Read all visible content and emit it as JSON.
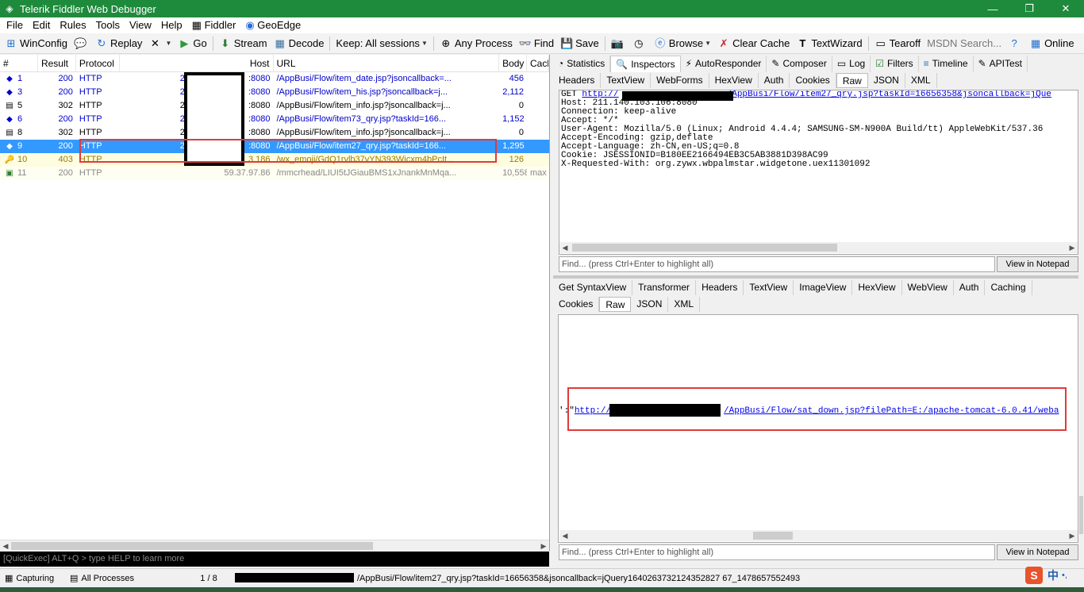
{
  "window": {
    "title": "Telerik Fiddler Web Debugger",
    "minimize": "—",
    "maximize": "❐",
    "close": "✕"
  },
  "menu": [
    {
      "label": "File"
    },
    {
      "label": "Edit"
    },
    {
      "label": "Rules"
    },
    {
      "label": "Tools"
    },
    {
      "label": "View"
    },
    {
      "label": "Help"
    },
    {
      "label": "Fiddler"
    },
    {
      "label": "GeoEdge"
    }
  ],
  "toolbar": {
    "winconfig": "WinConfig",
    "replay": "Replay",
    "go": "Go",
    "stream": "Stream",
    "decode": "Decode",
    "keep": "Keep: All sessions",
    "any_process": "Any Process",
    "find": "Find",
    "save": "Save",
    "browse": "Browse",
    "clear_cache": "Clear Cache",
    "textwizard": "TextWizard",
    "tearoff": "Tearoff",
    "msdn_search": "MSDN Search...",
    "online": "Online"
  },
  "grid": {
    "headers": {
      "num": "#",
      "result": "Result",
      "protocol": "Protocol",
      "host": "Host",
      "url": "URL",
      "body": "Body",
      "caching": "Cach"
    },
    "rows": [
      {
        "num": "1",
        "result": "200",
        "protocol": "HTTP",
        "host": "2",
        "port": ":8080",
        "url": "/AppBusi/Flow/item_date.jsp?jsoncallback=...",
        "body": "456",
        "caching": "",
        "icon": "◆"
      },
      {
        "num": "3",
        "result": "200",
        "protocol": "HTTP",
        "host": "2",
        "port": ":8080",
        "url": "/AppBusi/Flow/item_his.jsp?jsoncallback=j...",
        "body": "2,112",
        "caching": "",
        "icon": "◆"
      },
      {
        "num": "5",
        "result": "302",
        "protocol": "HTTP",
        "host": "2",
        "port": ":8080",
        "url": "/AppBusi/Flow/item_info.jsp?jsoncallback=j...",
        "body": "0",
        "caching": "",
        "icon": "▤"
      },
      {
        "num": "6",
        "result": "200",
        "protocol": "HTTP",
        "host": "2",
        "port": ":8080",
        "url": "/AppBusi/Flow/item73_qry.jsp?taskId=166...",
        "body": "1,152",
        "caching": "",
        "icon": "◆"
      },
      {
        "num": "8",
        "result": "302",
        "protocol": "HTTP",
        "host": "2",
        "port": ":8080",
        "url": "/AppBusi/Flow/item_info.jsp?jsoncallback=j...",
        "body": "0",
        "caching": "",
        "icon": "▤"
      },
      {
        "num": "9",
        "result": "200",
        "protocol": "HTTP",
        "host": "2",
        "port": ":8080",
        "url": "/AppBusi/Flow/item27_qry.jsp?taskId=166...",
        "body": "1,295",
        "caching": "",
        "icon": "◆"
      },
      {
        "num": "10",
        "result": "403",
        "protocol": "HTTP",
        "host": "",
        "port": "3.186",
        "url": "/wx_emoji/GdQ1rvlb37vYN393Wicxm4bPcIt...",
        "body": "126",
        "caching": "",
        "icon": "🔑"
      },
      {
        "num": "11",
        "result": "200",
        "protocol": "HTTP",
        "host": "",
        "port": "59.37.97.86",
        "url": "/mmcrhead/LIUI5tJGiauBMS1xJnankMnMqa...",
        "body": "10,558",
        "caching": "max",
        "icon": "▣"
      }
    ]
  },
  "quickexec": "[QuickExec] ALT+Q > type HELP to learn more",
  "tabs_main": [
    {
      "label": "Statistics",
      "icon": "◔"
    },
    {
      "label": "Inspectors",
      "icon": "🔍"
    },
    {
      "label": "AutoResponder",
      "icon": "⚡"
    },
    {
      "label": "Composer",
      "icon": "✎"
    },
    {
      "label": "Log",
      "icon": "▭"
    },
    {
      "label": "Filters",
      "icon": "☑"
    },
    {
      "label": "Timeline",
      "icon": "≡"
    },
    {
      "label": "APITest",
      "icon": "✎"
    }
  ],
  "req_tabs": [
    "Headers",
    "TextView",
    "WebForms",
    "HexView",
    "Auth",
    "Cookies",
    "Raw",
    "JSON",
    "XML"
  ],
  "request": {
    "get": "GET ",
    "get_link_start": "http://",
    "get_link_end": "/AppBusi/Flow/item27_qry.jsp?taskId=16656358&jsoncallback=jQue",
    "lines": [
      "Host: 211.140.103.106:8080",
      "Connection: keep-alive",
      "Accept: */*",
      "User-Agent: Mozilla/5.0 (Linux; Android 4.4.4; SAMSUNG-SM-N900A Build/tt) AppleWebKit/537.36",
      "Accept-Encoding: gzip,deflate",
      "Accept-Language: zh-CN,en-US;q=0.8",
      "Cookie: JSESSIONID=B180EE2166494EB3C5AB3881D398AC99",
      "X-Requested-With: org.zywx.wbpalmstar.widgetone.uex11301092"
    ]
  },
  "find_placeholder": "Find... (press Ctrl+Enter to highlight all)",
  "view_in_notepad": "View in Notepad",
  "resp_tabs_row1": [
    "Get SyntaxView",
    "Transformer",
    "Headers",
    "TextView",
    "ImageView",
    "HexView",
    "WebView",
    "Auth",
    "Caching"
  ],
  "resp_tabs_row2": [
    "Cookies",
    "Raw",
    "JSON",
    "XML"
  ],
  "response": {
    "prefix": "':\"",
    "link_start": "http://",
    "link_end": "/AppBusi/Flow/sat_down.jsp?filePath=E:/apache-tomcat-6.0.41/weba"
  },
  "status": {
    "capturing": "Capturing",
    "processes": "All Processes",
    "count": "1 / 8",
    "url": "/AppBusi/Flow/item27_qry.jsp?taskId=16656358&jsoncallback=jQuery1640263732124352827 67_1478657552493"
  },
  "ime": {
    "logo": "S",
    "lang": "中",
    "extra": "•,"
  },
  "colors": {
    "titlebar": "#1e8a3c",
    "selected_row": "#3399ff",
    "highlight": "#e03a3a",
    "link": "#0000ee"
  }
}
